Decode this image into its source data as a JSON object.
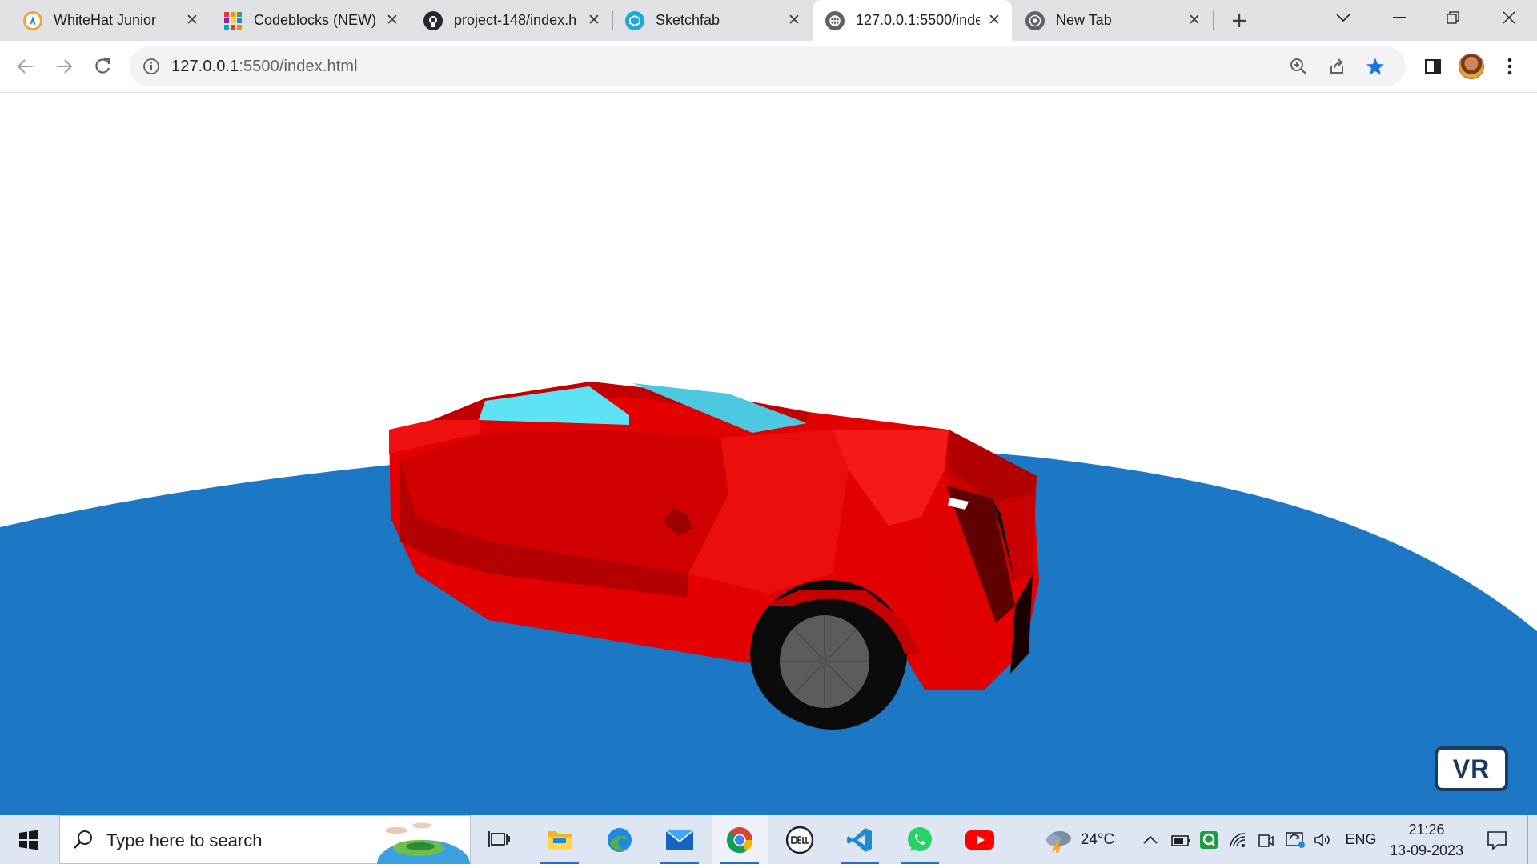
{
  "browser": {
    "tabs": [
      {
        "title": "WhiteHat Junior",
        "icon": "whitehat-icon",
        "active": false
      },
      {
        "title": "Codeblocks (NEW)",
        "icon": "codeblocks-icon",
        "active": false
      },
      {
        "title": "project-148/index.h",
        "icon": "github-icon",
        "active": false
      },
      {
        "title": "Sketchfab",
        "icon": "sketchfab-icon",
        "active": false
      },
      {
        "title": "127.0.0.1:5500/inde",
        "icon": "globe-icon",
        "active": true
      },
      {
        "title": "New Tab",
        "icon": "chrome-icon",
        "active": false
      }
    ],
    "url_host": "127.0.0.1",
    "url_path": ":5500/index.html"
  },
  "scene": {
    "vr_label": "VR",
    "ground_color": "#1c78c4",
    "car_color": "#e50000",
    "glass_color": "#5ee3f5"
  },
  "taskbar": {
    "search_placeholder": "Type here to search",
    "weather": "24°C",
    "language": "ENG",
    "time": "21:26",
    "date": "13-09-2023"
  }
}
